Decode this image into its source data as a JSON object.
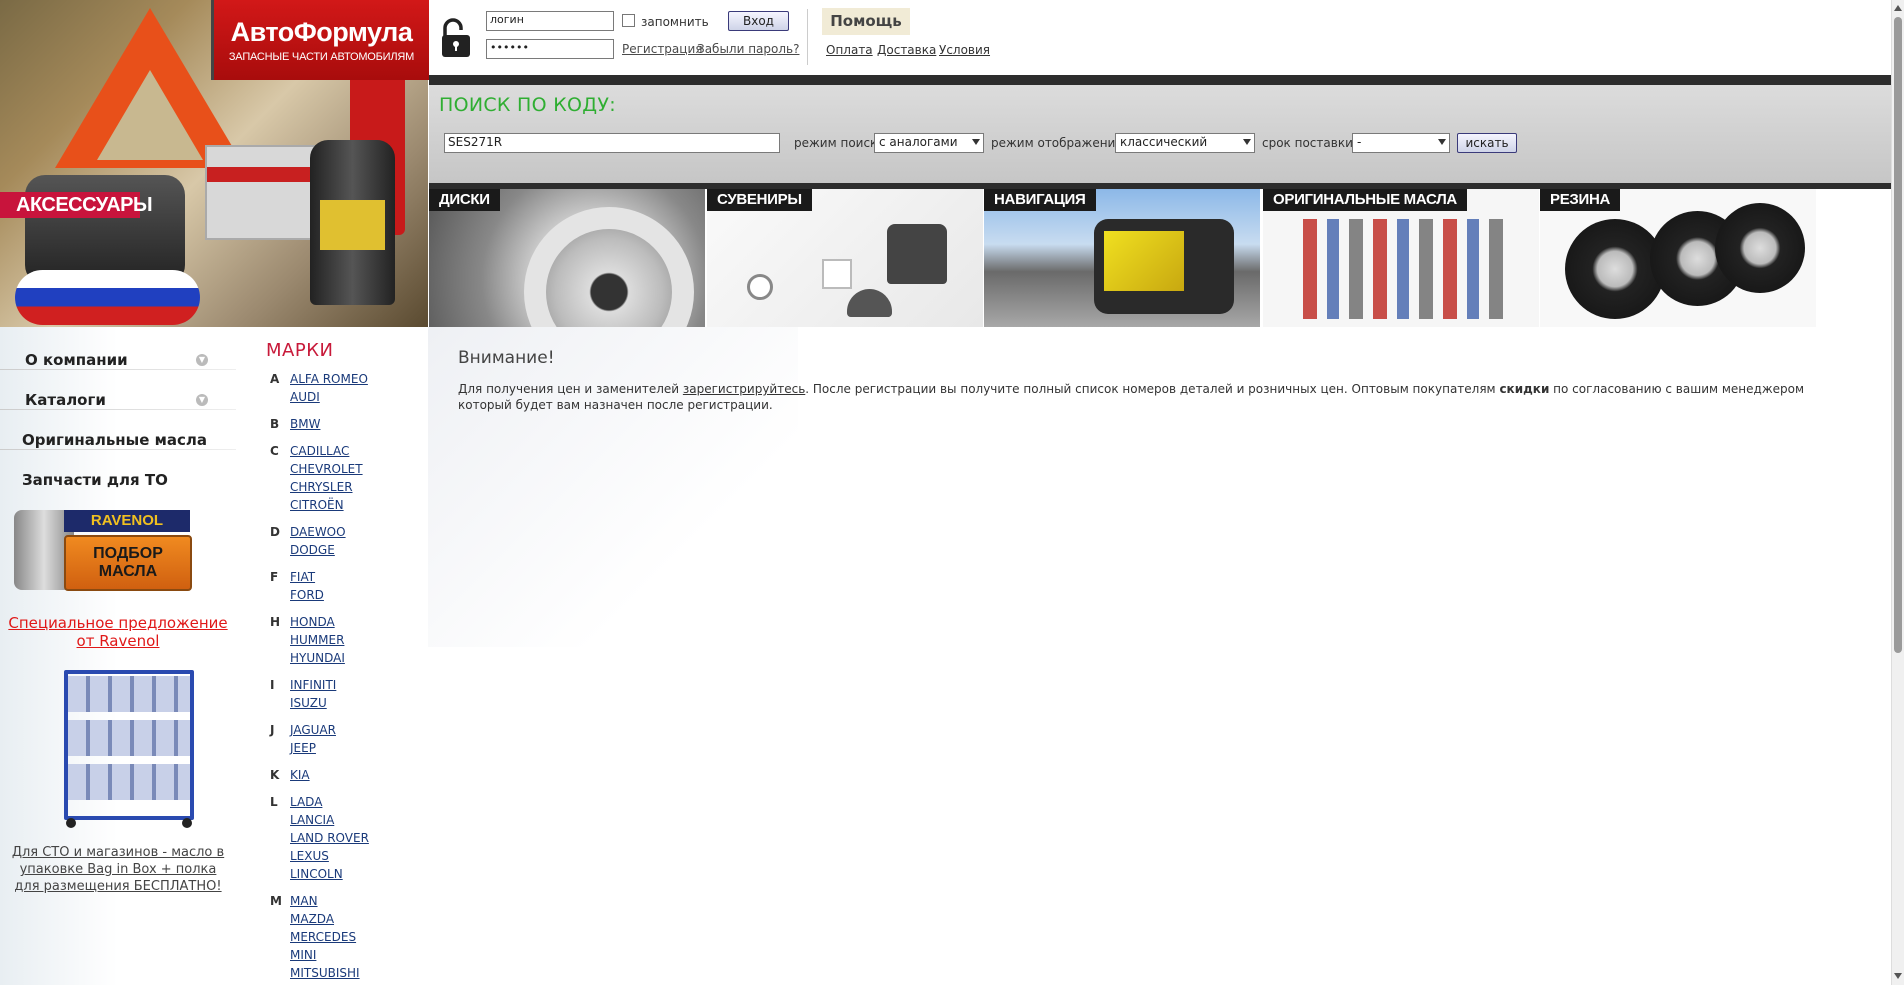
{
  "hero": {
    "accessories_label": "АКСЕССУАРЫ"
  },
  "logo": {
    "title": "АвтоФормула",
    "subtitle": "ЗАПАСНЫЕ ЧАСТИ АВТОМОБИЛЯМ"
  },
  "login": {
    "login_value": "логин",
    "password_value": "••••••",
    "remember_label": "запомнить",
    "enter_label": "Вход",
    "register_label": "Регистрация",
    "forgot_label": "Забыли пароль?"
  },
  "help": {
    "title": "Помощь",
    "links": [
      "Оплата",
      "Доставка",
      "Условия"
    ]
  },
  "search": {
    "title": "ПОИСК ПО КОДУ:",
    "code_value": "SES271R",
    "mode_label": "режим поиска",
    "mode_value": "с аналогами",
    "view_label": "режим отображения",
    "view_value": "классический",
    "term_label": "срок поставки",
    "term_value": "-",
    "button_label": "искать"
  },
  "banners": [
    "ДИСКИ",
    "СУВЕНИРЫ",
    "НАВИГАЦИЯ",
    "ОРИГИНАЛЬНЫЕ МАСЛА",
    "РЕЗИНА"
  ],
  "nav": {
    "items": [
      "О компании",
      "Каталоги",
      "Оригинальные масла",
      "Запчасти для ТО"
    ],
    "ravenol_top": "RAVENOL",
    "ravenol_sign_1": "ПОДБОР",
    "ravenol_sign_2": "МАСЛА",
    "special_offer": "Специальное предложение от Ravenol",
    "promo_text": "Для СТО и магазинов - масло в упаковке Bag in Box + полка для размещения БЕСПЛАТНО!"
  },
  "brands": {
    "title": "МАРКИ",
    "groups": [
      {
        "letter": "A",
        "items": [
          "ALFA ROMEO",
          "AUDI"
        ]
      },
      {
        "letter": "B",
        "items": [
          "BMW"
        ]
      },
      {
        "letter": "C",
        "items": [
          "CADILLAC",
          "CHEVROLET",
          "CHRYSLER",
          "CITROËN"
        ]
      },
      {
        "letter": "D",
        "items": [
          "DAEWOO",
          "DODGE"
        ]
      },
      {
        "letter": "F",
        "items": [
          "FIAT",
          "FORD"
        ]
      },
      {
        "letter": "H",
        "items": [
          "HONDA",
          "HUMMER",
          "HYUNDAI"
        ]
      },
      {
        "letter": "I",
        "items": [
          "INFINITI",
          "ISUZU"
        ]
      },
      {
        "letter": "J",
        "items": [
          "JAGUAR",
          "JEEP"
        ]
      },
      {
        "letter": "K",
        "items": [
          "KIA"
        ]
      },
      {
        "letter": "L",
        "items": [
          "LADA",
          "LANCIA",
          "LAND ROVER",
          "LEXUS",
          "LINCOLN"
        ]
      },
      {
        "letter": "M",
        "items": [
          "MAN",
          "MAZDA",
          "MERCEDES",
          "MINI",
          "MITSUBISHI"
        ]
      }
    ]
  },
  "content": {
    "heading": "Внимание!",
    "text_before": "Для получения цен и заменителей ",
    "register_link": "зарегистрируйтесь",
    "text_middle": ". После регистрации вы получите полный список номеров деталей и розничных цен. Оптовым покупателям ",
    "discount_word": "скидки",
    "text_after": " по согласованию с вашим менеджером который будет вам назначен после регистрации."
  },
  "colors": {
    "brand_red": "#c8143c",
    "search_green": "#2fae32",
    "link_blue": "#1a3a7a",
    "special_red": "#e01818"
  }
}
